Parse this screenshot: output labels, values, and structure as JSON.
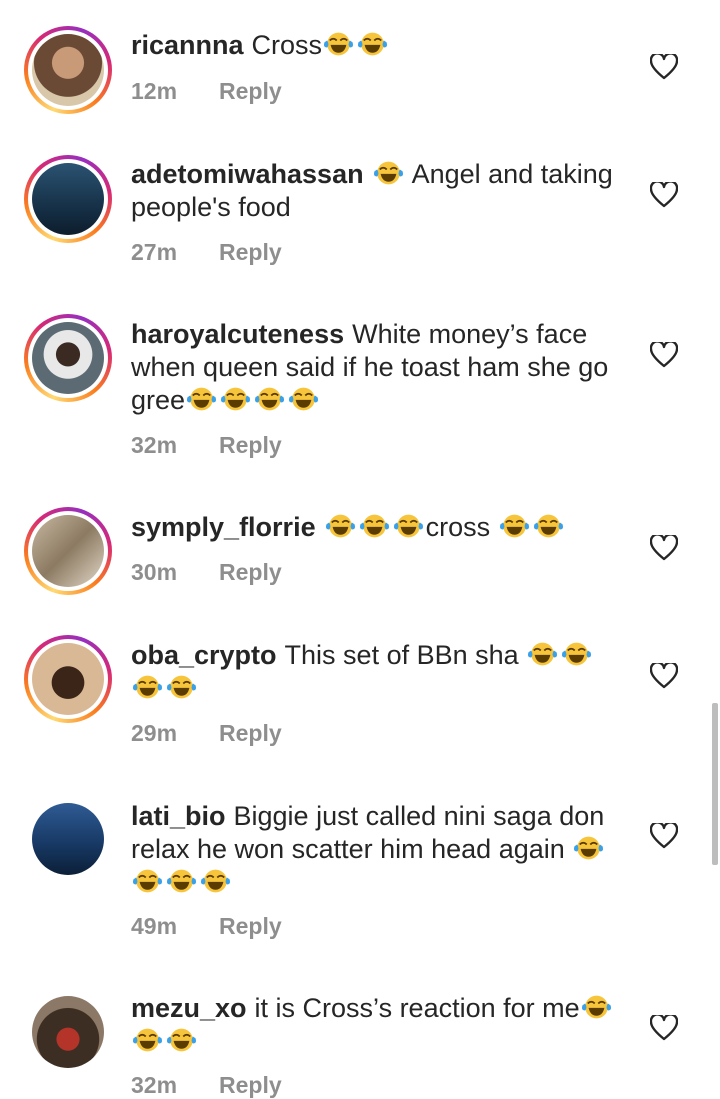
{
  "comments": [
    {
      "username": "ricannna",
      "text": "Cross",
      "emojis_after": 2,
      "time": "12m",
      "reply": "Reply",
      "story_ring": true,
      "avatar_color": "#8a6a4a"
    },
    {
      "username": "adetomiwahassan",
      "emoji_before": true,
      "text": "Angel and taking people's food",
      "time": "27m",
      "reply": "Reply",
      "story_ring": true,
      "avatar_color": "#1c3d5a"
    },
    {
      "username": "haroyalcuteness",
      "text": "White money’s face when queen said if he toast ham she go gree",
      "emojis_after": 4,
      "time": "32m",
      "reply": "Reply",
      "story_ring": true,
      "avatar_color": "#4a4a4a"
    },
    {
      "username": "symply_florrie",
      "emoji_before_count": 3,
      "text": "cross",
      "emojis_after": 2,
      "time": "30m",
      "reply": "Reply",
      "story_ring": true,
      "avatar_color": "#a6917a"
    },
    {
      "username": "oba_crypto",
      "text": "This set of BBn sha",
      "emojis_after": 4,
      "time": "29m",
      "reply": "Reply",
      "story_ring": true,
      "avatar_color": "#c9a27e"
    },
    {
      "username": "lati_bio",
      "text": "Biggie just called nini saga don relax he won scatter him head again",
      "emojis_after": 4,
      "time": "49m",
      "reply": "Reply",
      "story_ring": false,
      "avatar_color": "#1f3f6e"
    },
    {
      "username": "mezu_xo",
      "text": "it is Cross’s reaction for me",
      "emojis_after": 3,
      "time": "32m",
      "reply": "Reply",
      "story_ring": false,
      "avatar_color": "#5a4638"
    }
  ],
  "colors": {
    "text": "#262626",
    "meta": "#8e8e8e",
    "emoji_face": "#f7c53c",
    "emoji_tear": "#3aa0e8"
  },
  "icons": {
    "like": "heart-outline-icon",
    "emoji": "tears-of-joy-emoji"
  }
}
